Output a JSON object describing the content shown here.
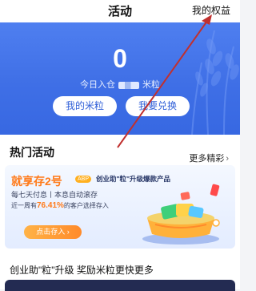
{
  "header": {
    "title": "活动",
    "rights_link": "我的权益"
  },
  "hero": {
    "balance": "0",
    "today_prefix": "今日入仓",
    "today_unit": "米粒",
    "buttons": {
      "my_rice": "我的米粒",
      "redeem": "我要兑换"
    }
  },
  "section": {
    "title": "热门活动",
    "more": "更多精彩",
    "more_chevron": "›"
  },
  "banner": {
    "headline": "就享存2号",
    "badge": "ABP",
    "promo": "创业助\"粒\"升级爆款产品",
    "line2": "每七天付息丨本息自动滚存",
    "line3_prefix": "近一周有",
    "line3_percent": "76.41%",
    "line3_suffix": "的客户选择存入",
    "cta": "点击存入 ›"
  },
  "activity_desc": "创业助\"粒\"升级 奖励米粒更快更多",
  "colors": {
    "hero_blue": "#3f6fe6",
    "accent_orange": "#ff7a1a",
    "annotation_red": "#c0302f"
  }
}
